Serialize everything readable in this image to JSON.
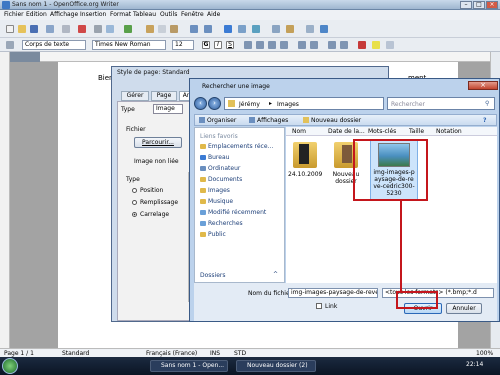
{
  "window": {
    "title": "Sans nom 1 - OpenOffice.org Writer"
  },
  "menu": [
    "Fichier",
    "Edition",
    "Affichage",
    "Insertion",
    "Format",
    "Tableau",
    "Outils",
    "Fenêtre",
    "Aide"
  ],
  "format_bar": {
    "style": "Corps de texte",
    "font": "Times New Roman",
    "size": "12"
  },
  "document": {
    "text_left": "Bien",
    "text_right": "ment"
  },
  "style_dialog": {
    "title": "Style de page: Standard",
    "tabs": [
      "Gérer",
      "Page",
      "Ar"
    ],
    "type_label": "Type",
    "type_value": "Image",
    "file_label": "Fichier",
    "browse_button": "Parcourir...",
    "unlinked": "Image non liée",
    "type_section": "Type",
    "options": [
      "Position",
      "Remplissage",
      "Carrelage"
    ],
    "selected_option": "Carrelage"
  },
  "file_dialog": {
    "title": "Rechercher une image",
    "breadcrumb": [
      "Jérémy",
      "Images"
    ],
    "search_placeholder": "Rechercher",
    "toolbar": {
      "organize": "Organiser",
      "views": "Affichages",
      "new_folder": "Nouveau dossier"
    },
    "favorites_header": "Liens favoris",
    "favorites": [
      {
        "label": "Emplacements réce...",
        "color": "#e0b94a"
      },
      {
        "label": "Bureau",
        "color": "#3b7bd4"
      },
      {
        "label": "Ordinateur",
        "color": "#6a8fbf"
      },
      {
        "label": "Documents",
        "color": "#e0b94a"
      },
      {
        "label": "Images",
        "color": "#e0b94a"
      },
      {
        "label": "Musique",
        "color": "#e0b94a"
      },
      {
        "label": "Modifié récemment",
        "color": "#6aa0d8"
      },
      {
        "label": "Recherches",
        "color": "#6aa0d8"
      },
      {
        "label": "Public",
        "color": "#e0b94a"
      }
    ],
    "folders_label": "Dossiers",
    "columns": [
      "Nom",
      "Date de la...",
      "Mots-clés",
      "Taille",
      "Notation"
    ],
    "items": [
      {
        "label": "24.10.2009",
        "kind": "folder"
      },
      {
        "label": "Nouveau dossier",
        "kind": "folder"
      },
      {
        "label": "img-images-paysage-de-reve-cedric300-5230",
        "kind": "image"
      }
    ],
    "filename_label": "Nom du fichier :",
    "filename_value": "img-images-paysage-de-reve-cedric300-5",
    "filetype_value": "<tous les formats> (*.bmp;*.d",
    "link_label": "Link",
    "open_button": "Ouvrir",
    "cancel_button": "Annuler"
  },
  "status": {
    "page": "Page 1 / 1",
    "style": "Standard",
    "lang": "Français (France)",
    "ins": "INS",
    "std": "STD",
    "zoom": "100%"
  },
  "taskbar": {
    "items": [
      "Sans nom 1 - Open...",
      "Nouveau dossier (2)"
    ],
    "time": "22:14"
  },
  "colors": {
    "highlight": "#c4161c",
    "selection": "#cde4fb"
  }
}
